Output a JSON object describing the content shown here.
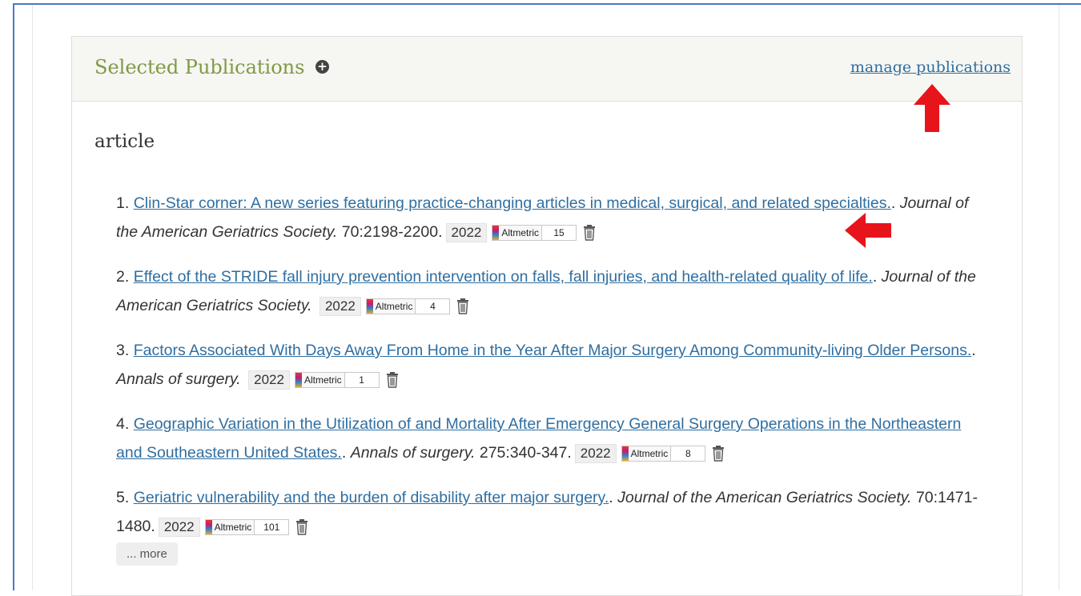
{
  "header": {
    "title": "Selected Publications",
    "add_icon": "plus-circle-icon",
    "manage_link": "manage publications"
  },
  "section": {
    "heading": "article"
  },
  "publications": [
    {
      "number": "1.",
      "title": "Clin-Star corner: A new series featuring practice-changing articles in medical, surgical, and related specialties.",
      "sep": ".",
      "journal": "Journal of the American Geriatrics Society.",
      "pages": "70:2198-2200.",
      "year": "2022",
      "altmetric_label": "Altmetric",
      "altmetric_score": "15"
    },
    {
      "number": "2.",
      "title": "Effect of the STRIDE fall injury prevention intervention on falls, fall injuries, and health-related quality of life.",
      "sep": ".",
      "journal": "Journal of the American Geriatrics Society.",
      "pages": "",
      "year": "2022",
      "altmetric_label": "Altmetric",
      "altmetric_score": "4"
    },
    {
      "number": "3.",
      "title": "Factors Associated With Days Away From Home in the Year After Major Surgery Among Community-living Older Persons.",
      "sep": ".",
      "journal": "Annals of surgery.",
      "pages": "",
      "year": "2022",
      "altmetric_label": "Altmetric",
      "altmetric_score": "1"
    },
    {
      "number": "4.",
      "title": "Geographic Variation in the Utilization of and Mortality After Emergency General Surgery Operations in the Northeastern and Southeastern United States.",
      "sep": ".",
      "journal": "Annals of surgery.",
      "pages": "275:340-347.",
      "year": "2022",
      "altmetric_label": "Altmetric",
      "altmetric_score": "8"
    },
    {
      "number": "5.",
      "title": "Geriatric vulnerability and the burden of disability after major surgery.",
      "sep": ".",
      "journal": "Journal of the American Geriatrics Society.",
      "pages": "70:1471-1480.",
      "year": "2022",
      "altmetric_label": "Altmetric",
      "altmetric_score": "101"
    }
  ],
  "more_label": "... more",
  "colors": {
    "title_green": "#7f9a45",
    "link_blue": "#2f6ea0",
    "arrow_red": "#e8141b",
    "frame_blue": "#4a78c8"
  }
}
